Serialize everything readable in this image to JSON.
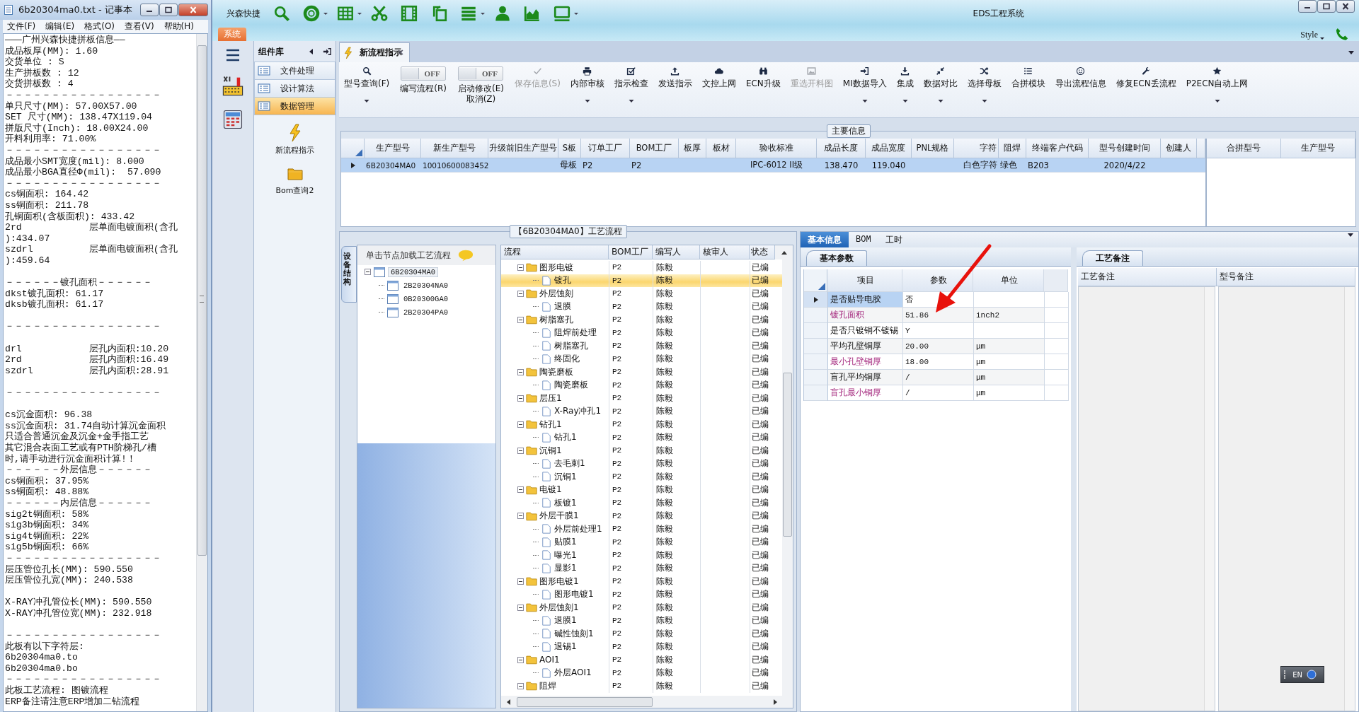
{
  "notepad": {
    "title": "6b20304ma0.txt - 记事本",
    "menu": [
      "文件(F)",
      "编辑(E)",
      "格式(O)",
      "查看(V)",
      "帮助(H)"
    ],
    "blocks": [
      {
        "lines": [
          "———广州兴森快捷拼板信息——",
          "成品板厚(MM): 1.60",
          "交货单位 : S",
          "生产拼板数 : 12",
          "交货拼板数 : 4",
          "－－－－－－－－－－－－－－－－－",
          "单只尺寸(MM): 57.00X57.00",
          "SET 尺寸(MM): 138.47X119.04",
          "拼版尺寸(Inch): 18.00X24.00",
          "开料利用率: 71.00%",
          "－－－－－－－－－－－－－－－－－",
          "成品最小SMT宽度(mil): 8.000",
          "成品最小BGA直径Φ(mil):  57.090",
          "－－－－－－－－－－－－－－－－－",
          "cs铜面积: 164.42",
          "ss铜面积: 211.78",
          "孔铜面积(含板面积): 433.42",
          "2rd            层单面电镀面积(含孔",
          "):434.07",
          "szdrl          层单面电镀面积(含孔",
          "):459.64"
        ]
      },
      {
        "lines": [
          "－－－－－－镀孔面积－－－－－－",
          "dkst镀孔面积: 61.17",
          "dksb镀孔面积: 61.17"
        ]
      },
      {
        "lines": [
          "－－－－－－－－－－－－－－－－－"
        ]
      },
      {
        "lines": [
          "drl            层孔内面积:10.20",
          "2rd            层孔内面积:16.49",
          "szdrl          层孔内面积:28.91"
        ]
      },
      {
        "lines": [
          "－－－－－－－－－－－－－－－－－"
        ]
      },
      {
        "lines": [
          "cs沉金面积: 96.38",
          "ss沉金面积: 31.74自动计算沉金面积",
          "只适合普通沉金及沉金+金手指工艺",
          "其它混合表面工艺或有PTH阶梯孔/槽",
          "时,请手动进行沉金面积计算!！",
          "－－－－－－外层信息－－－－－－",
          "cs铜面积: 37.95%",
          "ss铜面积: 48.88%",
          "－－－－－－内层信息－－－－－－",
          "sig2t铜面积: 58%",
          "sig3b铜面积: 34%",
          "sig4t铜面积: 22%",
          "sig5b铜面积: 66%",
          "－－－－－－－－－－－－－－－－－",
          "层压管位孔长(MM): 590.550",
          "层压管位孔宽(MM): 240.538"
        ]
      },
      {
        "lines": [
          "X-RAY冲孔管位长(MM): 590.550",
          "X-RAY冲孔管位宽(MM): 232.918"
        ]
      },
      {
        "lines": [
          "－－－－－－－－－－－－－－－－－",
          "此板有以下字符层:",
          "6b20304ma0.to",
          "6b20304ma0.bo",
          "－－－－－－－－－－－－－－－－－",
          "此板工艺流程: 图镀流程",
          "ERP备注请注意ERP增加二钻流程"
        ]
      }
    ]
  },
  "app": {
    "title": "EDS工程系统",
    "brand": "兴森快捷",
    "ribbon_tab": "系统",
    "style_label": "Style"
  },
  "sidebar": {
    "title": "组件库",
    "items": [
      {
        "label": "文件处理",
        "selected": false
      },
      {
        "label": "设计算法",
        "selected": false
      },
      {
        "label": "数据管理",
        "selected": true
      }
    ],
    "tools": [
      {
        "label": "新流程指示"
      },
      {
        "label": "Bom查询2"
      }
    ]
  },
  "doc_tab": {
    "label": "新流程指示"
  },
  "toolbar": [
    {
      "kind": "button",
      "label": "型号查询(F)",
      "dropdown": true,
      "disabled": false
    },
    {
      "kind": "toggle",
      "label": "编写流程(R)",
      "switch_text": "OFF",
      "on": false
    },
    {
      "kind": "toggle",
      "label": "启动修改(E)\n取消(Z)",
      "switch_text": "OFF",
      "on": false
    },
    {
      "kind": "button",
      "label": "保存信息(S)",
      "dropdown": false,
      "disabled": true
    },
    {
      "kind": "button",
      "label": "内部审核",
      "dropdown": true,
      "disabled": false
    },
    {
      "kind": "button",
      "label": "指示检查",
      "dropdown": true,
      "disabled": false
    },
    {
      "kind": "button",
      "label": "发送指示",
      "dropdown": false,
      "disabled": false
    },
    {
      "kind": "button",
      "label": "文控上网",
      "dropdown": false,
      "disabled": false
    },
    {
      "kind": "button",
      "label": "ECN升级",
      "dropdown": false,
      "disabled": false
    },
    {
      "kind": "button",
      "label": "重选开料图",
      "dropdown": false,
      "disabled": true
    },
    {
      "kind": "button",
      "label": "MI数据导入",
      "dropdown": true,
      "disabled": false
    },
    {
      "kind": "button",
      "label": "集成",
      "dropdown": true,
      "disabled": false
    },
    {
      "kind": "button",
      "label": "数据对比",
      "dropdown": true,
      "disabled": false
    },
    {
      "kind": "button",
      "label": "选择母板",
      "dropdown": true,
      "disabled": false
    },
    {
      "kind": "button",
      "label": "合拼模块",
      "dropdown": false,
      "disabled": false
    },
    {
      "kind": "button",
      "label": "导出流程信息",
      "dropdown": false,
      "disabled": false
    },
    {
      "kind": "button",
      "label": "修复ECN丢流程",
      "dropdown": false,
      "disabled": false
    },
    {
      "kind": "button",
      "label": "P2ECN自动上网",
      "dropdown": true,
      "disabled": false
    }
  ],
  "main_info": {
    "title": "主要信息",
    "columns": [
      "生产型号",
      "新生产型号",
      "升级前旧生产型号",
      "S板",
      "订单工厂",
      "BOM工厂",
      "板厚",
      "板材",
      "验收标准",
      "成品长度",
      "成品宽度",
      "PNL规格",
      "字符",
      "阻焊",
      "终端客户代码",
      "型号创建时间",
      "创建人"
    ],
    "rows": [
      {
        "selected": true,
        "cells": [
          "6B20304MA0",
          "10010600083452",
          null,
          "母板",
          "P2",
          "P2",
          null,
          null,
          "IPC-6012 II级",
          "138.470",
          "119.040",
          null,
          "白色字符",
          "绿色",
          "B203",
          "2020/4/22",
          null
        ]
      }
    ],
    "side_columns": [
      "合拼型号",
      "生产型号"
    ]
  },
  "flow": {
    "title": "【6B20304MA0】工艺流程",
    "side_tab": "设备结构",
    "hint": "单击节点加载工艺流程",
    "tree": [
      {
        "label": "6B20304MA0",
        "selected": true,
        "expanded": true,
        "children": [
          {
            "label": "2B20304NA0",
            "selected": false
          },
          {
            "label": "0B20300GA0",
            "selected": false
          },
          {
            "label": "2B20304PA0",
            "selected": false
          }
        ]
      }
    ],
    "columns": [
      "流程",
      "BOM工厂",
      "编写人",
      "核审人",
      "状态"
    ],
    "steps": [
      {
        "kind": "group",
        "name": "图形电镀",
        "factory": "P2",
        "writer": "陈毅",
        "status": "已编",
        "selected": false,
        "expanded": true,
        "children": [
          {
            "kind": "step",
            "name": "镀孔",
            "factory": "P2",
            "writer": "陈毅",
            "status": "已编",
            "selected": true
          }
        ]
      },
      {
        "kind": "group",
        "name": "外层蚀刻",
        "factory": "P2",
        "writer": "陈毅",
        "status": "已编",
        "selected": false,
        "expanded": true,
        "children": [
          {
            "kind": "step",
            "name": "退膜",
            "factory": "P2",
            "writer": "陈毅",
            "status": "已编",
            "selected": false
          }
        ]
      },
      {
        "kind": "group",
        "name": "树脂塞孔",
        "factory": "P2",
        "writer": "陈毅",
        "status": "已编",
        "selected": false,
        "expanded": true,
        "children": [
          {
            "kind": "step",
            "name": "阻焊前处理",
            "factory": "P2",
            "writer": "陈毅",
            "status": "已编",
            "selected": false
          },
          {
            "kind": "step",
            "name": "树脂塞孔",
            "factory": "P2",
            "writer": "陈毅",
            "status": "已编",
            "selected": false
          },
          {
            "kind": "step",
            "name": "终固化",
            "factory": "P2",
            "writer": "陈毅",
            "status": "已编",
            "selected": false
          }
        ]
      },
      {
        "kind": "group",
        "name": "陶瓷磨板",
        "factory": "P2",
        "writer": "陈毅",
        "status": "已编",
        "selected": false,
        "expanded": true,
        "children": [
          {
            "kind": "step",
            "name": "陶瓷磨板",
            "factory": "P2",
            "writer": "陈毅",
            "status": "已编",
            "selected": false
          }
        ]
      },
      {
        "kind": "group",
        "name": "层压1",
        "factory": "P2",
        "writer": "陈毅",
        "status": "已编",
        "selected": false,
        "expanded": true,
        "children": [
          {
            "kind": "step",
            "name": "X-Ray冲孔1",
            "factory": "P2",
            "writer": "陈毅",
            "status": "已编",
            "selected": false
          }
        ]
      },
      {
        "kind": "group",
        "name": "钻孔1",
        "factory": "P2",
        "writer": "陈毅",
        "status": "已编",
        "selected": false,
        "expanded": true,
        "children": [
          {
            "kind": "step",
            "name": "钻孔1",
            "factory": "P2",
            "writer": "陈毅",
            "status": "已编",
            "selected": false
          }
        ]
      },
      {
        "kind": "group",
        "name": "沉铜1",
        "factory": "P2",
        "writer": "陈毅",
        "status": "已编",
        "selected": false,
        "expanded": true,
        "children": [
          {
            "kind": "step",
            "name": "去毛刺1",
            "factory": "P2",
            "writer": "陈毅",
            "status": "已编",
            "selected": false
          },
          {
            "kind": "step",
            "name": "沉铜1",
            "factory": "P2",
            "writer": "陈毅",
            "status": "已编",
            "selected": false
          }
        ]
      },
      {
        "kind": "group",
        "name": "电镀1",
        "factory": "P2",
        "writer": "陈毅",
        "status": "已编",
        "selected": false,
        "expanded": true,
        "children": [
          {
            "kind": "step",
            "name": "板镀1",
            "factory": "P2",
            "writer": "陈毅",
            "status": "已编",
            "selected": false
          }
        ]
      },
      {
        "kind": "group",
        "name": "外层干膜1",
        "factory": "P2",
        "writer": "陈毅",
        "status": "已编",
        "selected": false,
        "expanded": true,
        "children": [
          {
            "kind": "step",
            "name": "外层前处理1",
            "factory": "P2",
            "writer": "陈毅",
            "status": "已编",
            "selected": false
          },
          {
            "kind": "step",
            "name": "贴膜1",
            "factory": "P2",
            "writer": "陈毅",
            "status": "已编",
            "selected": false
          },
          {
            "kind": "step",
            "name": "曝光1",
            "factory": "P2",
            "writer": "陈毅",
            "status": "已编",
            "selected": false
          },
          {
            "kind": "step",
            "name": "显影1",
            "factory": "P2",
            "writer": "陈毅",
            "status": "已编",
            "selected": false
          }
        ]
      },
      {
        "kind": "group",
        "name": "图形电镀1",
        "factory": "P2",
        "writer": "陈毅",
        "status": "已编",
        "selected": false,
        "expanded": true,
        "children": [
          {
            "kind": "step",
            "name": "图形电镀1",
            "factory": "P2",
            "writer": "陈毅",
            "status": "已编",
            "selected": false
          }
        ]
      },
      {
        "kind": "group",
        "name": "外层蚀刻1",
        "factory": "P2",
        "writer": "陈毅",
        "status": "已编",
        "selected": false,
        "expanded": true,
        "children": [
          {
            "kind": "step",
            "name": "退膜1",
            "factory": "P2",
            "writer": "陈毅",
            "status": "已编",
            "selected": false
          },
          {
            "kind": "step",
            "name": "碱性蚀刻1",
            "factory": "P2",
            "writer": "陈毅",
            "status": "已编",
            "selected": false
          },
          {
            "kind": "step",
            "name": "退锡1",
            "factory": "P2",
            "writer": "陈毅",
            "status": "已编",
            "selected": false
          }
        ]
      },
      {
        "kind": "group",
        "name": "AOI1",
        "factory": "P2",
        "writer": "陈毅",
        "status": "已编",
        "selected": false,
        "expanded": true,
        "children": [
          {
            "kind": "step",
            "name": "外层AOI1",
            "factory": "P2",
            "writer": "陈毅",
            "status": "已编",
            "selected": false
          }
        ]
      },
      {
        "kind": "group",
        "name": "阻焊",
        "factory": "P2",
        "writer": "陈毅",
        "status": "已编",
        "selected": false,
        "expanded": true
      }
    ]
  },
  "detail": {
    "tabs": [
      {
        "label": "基本信息",
        "selected": true
      },
      {
        "label": "BOM",
        "selected": false
      },
      {
        "label": "工时",
        "selected": false
      }
    ],
    "params": {
      "tab": "基本参数",
      "columns": [
        "项目",
        "参数",
        "单位"
      ],
      "rows": [
        {
          "item": "是否贴导电胶",
          "value": "否",
          "highlight": false,
          "selected": true
        },
        {
          "item": "镀孔面积",
          "value": "51.86",
          "unit": "inch2",
          "highlight": true,
          "selected": false
        },
        {
          "item": "是否只镀铜不镀锡",
          "value": "Y",
          "highlight": false,
          "selected": false
        },
        {
          "item": "平均孔壁铜厚",
          "value": "20.00",
          "unit": "μm",
          "highlight": false,
          "selected": false
        },
        {
          "item": "最小孔壁铜厚",
          "value": "18.00",
          "unit": "μm",
          "highlight": true,
          "selected": false
        },
        {
          "item": "盲孔平均铜厚",
          "value": "/",
          "unit": "μm",
          "highlight": false,
          "selected": false
        },
        {
          "item": "盲孔最小铜厚",
          "value": "/",
          "unit": "μm",
          "highlight": true,
          "selected": false
        }
      ]
    },
    "notes": {
      "tab": "工艺备注",
      "columns": [
        "工艺备注",
        "型号备注"
      ]
    }
  },
  "language_bar": {
    "label": "EN"
  }
}
